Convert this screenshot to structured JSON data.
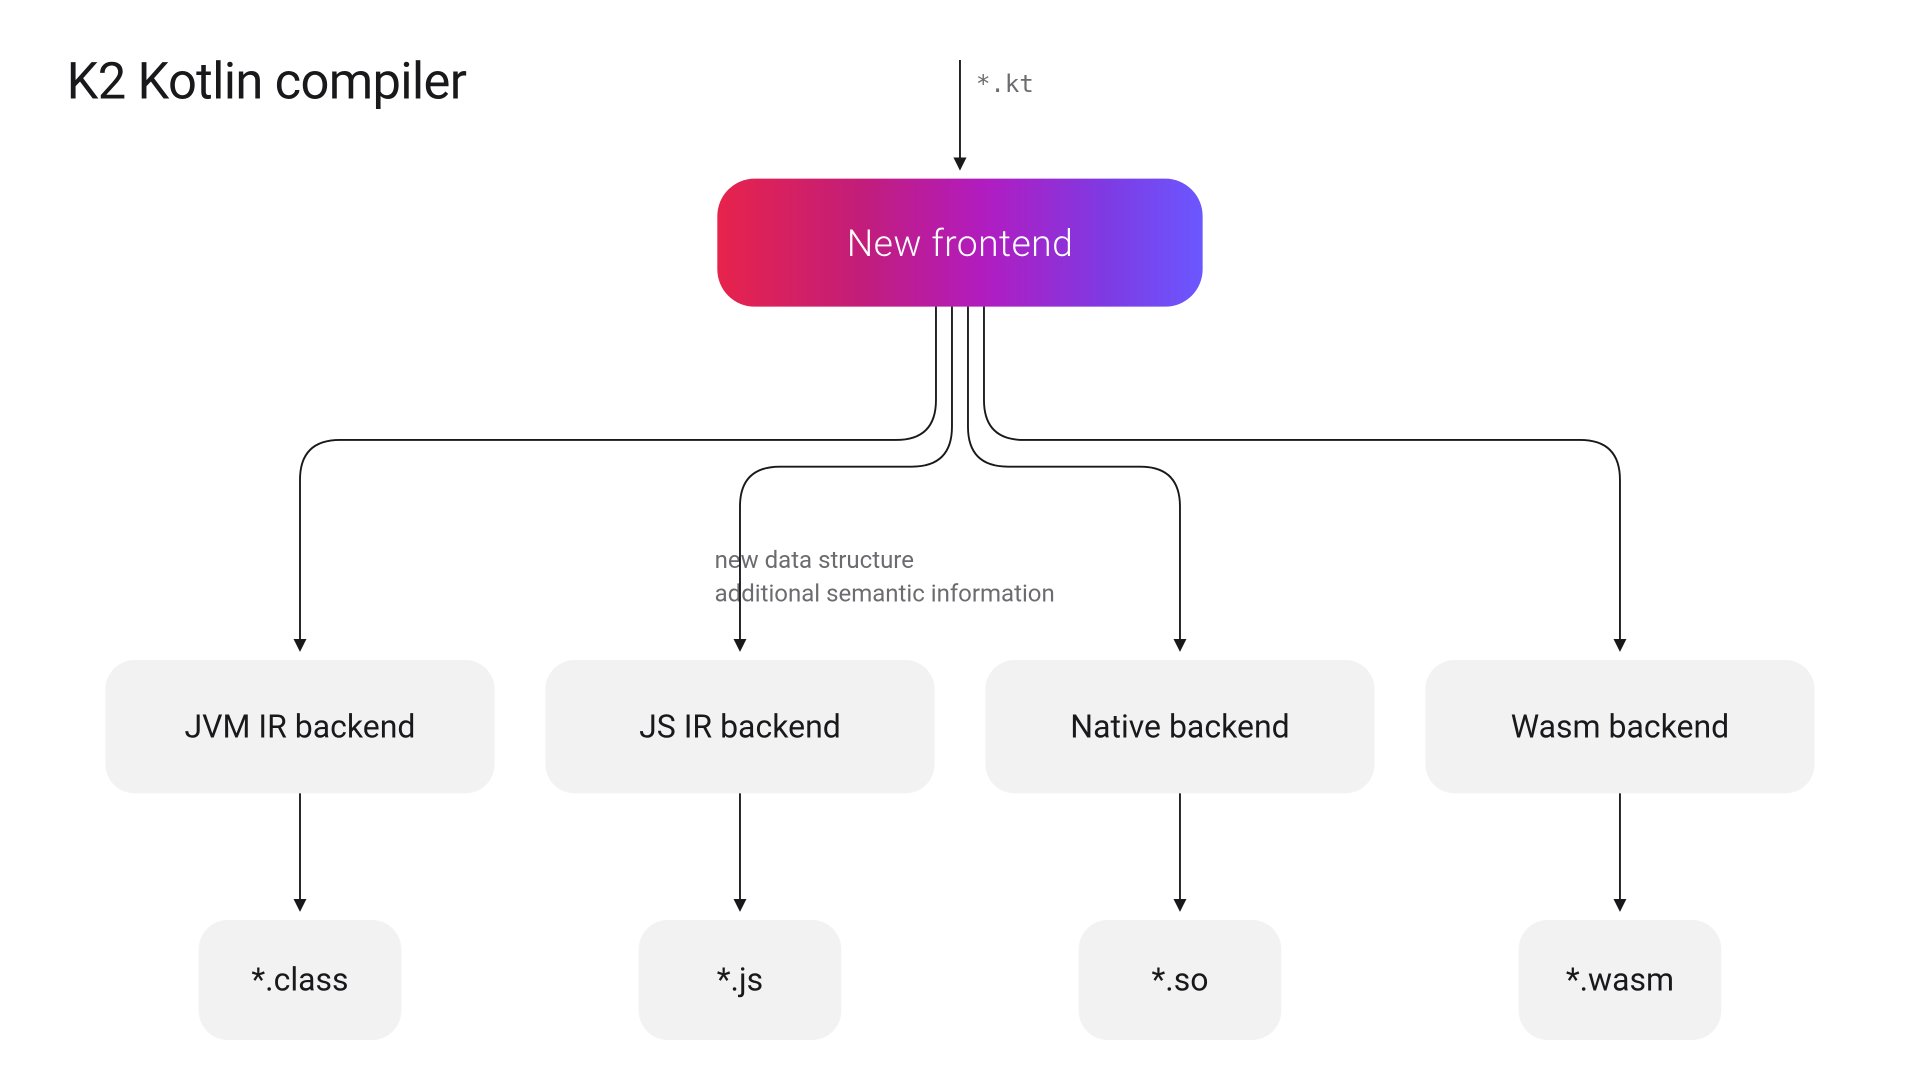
{
  "title": "K2 Kotlin compiler",
  "input_label": "*.kt",
  "frontend": {
    "label": "New frontend"
  },
  "midnote_line1": "new data structure",
  "midnote_line2": "additional semantic information",
  "backends": [
    {
      "label": "JVM IR backend",
      "output": "*.class"
    },
    {
      "label": "JS IR backend",
      "output": "*.js"
    },
    {
      "label": "Native backend",
      "output": "*.so"
    },
    {
      "label": "Wasm backend",
      "output": "*.wasm"
    }
  ],
  "chart_data": {
    "type": "diagram",
    "title": "K2 Kotlin compiler",
    "nodes": [
      {
        "id": "input",
        "label": "*.kt",
        "kind": "input"
      },
      {
        "id": "frontend",
        "label": "New frontend",
        "kind": "frontend"
      },
      {
        "id": "jvm",
        "label": "JVM IR backend",
        "kind": "backend"
      },
      {
        "id": "js",
        "label": "JS IR backend",
        "kind": "backend"
      },
      {
        "id": "native",
        "label": "Native backend",
        "kind": "backend"
      },
      {
        "id": "wasm",
        "label": "Wasm backend",
        "kind": "backend"
      },
      {
        "id": "out-jvm",
        "label": "*.class",
        "kind": "output"
      },
      {
        "id": "out-js",
        "label": "*.js",
        "kind": "output"
      },
      {
        "id": "out-native",
        "label": "*.so",
        "kind": "output"
      },
      {
        "id": "out-wasm",
        "label": "*.wasm",
        "kind": "output"
      }
    ],
    "edges": [
      {
        "from": "input",
        "to": "frontend"
      },
      {
        "from": "frontend",
        "to": "jvm",
        "label": "new data structure / additional semantic information"
      },
      {
        "from": "frontend",
        "to": "js",
        "label": "new data structure / additional semantic information"
      },
      {
        "from": "frontend",
        "to": "native",
        "label": "new data structure / additional semantic information"
      },
      {
        "from": "frontend",
        "to": "wasm",
        "label": "new data structure / additional semantic information"
      },
      {
        "from": "jvm",
        "to": "out-jvm"
      },
      {
        "from": "js",
        "to": "out-js"
      },
      {
        "from": "native",
        "to": "out-native"
      },
      {
        "from": "wasm",
        "to": "out-wasm"
      }
    ]
  }
}
